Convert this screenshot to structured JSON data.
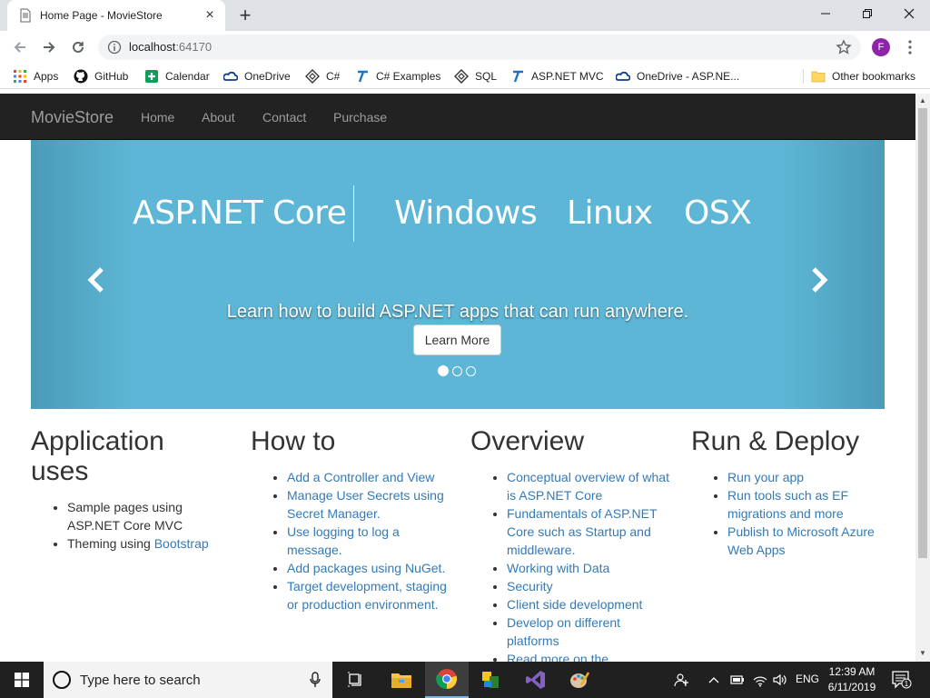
{
  "browser": {
    "tab_title": "Home Page - MovieStore",
    "url_host": "localhost",
    "url_port": ":64170",
    "profile_initial": "F",
    "bookmarks": [
      {
        "label": "Apps",
        "icon": "apps-grid-icon"
      },
      {
        "label": "GitHub",
        "icon": "github-icon"
      },
      {
        "label": "Calendar",
        "icon": "calendar-icon"
      },
      {
        "label": "OneDrive",
        "icon": "onedrive-icon"
      },
      {
        "label": "C#",
        "icon": "diamond-icon"
      },
      {
        "label": "C# Examples",
        "icon": "tutorial-t-icon"
      },
      {
        "label": "SQL",
        "icon": "diamond-icon"
      },
      {
        "label": "ASP.NET MVC",
        "icon": "tutorial-t-icon"
      },
      {
        "label": "OneDrive - ASP.NE...",
        "icon": "onedrive-icon"
      },
      {
        "label": "Other bookmarks",
        "icon": "folder-icon"
      }
    ]
  },
  "site": {
    "brand": "MovieStore",
    "nav": [
      "Home",
      "About",
      "Contact",
      "Purchase"
    ]
  },
  "carousel": {
    "hero_words": [
      "ASP.NET Core",
      "Windows",
      "Linux",
      "OSX"
    ],
    "caption": "Learn how to build ASP.NET apps that can run anywhere.",
    "button": "Learn More",
    "active_slide": 1,
    "slide_count": 3
  },
  "columns": [
    {
      "heading": "Application uses",
      "items": [
        {
          "text": "Sample pages using ASP.NET Core MVC",
          "link": ""
        },
        {
          "text": "Theming using ",
          "link": "Bootstrap"
        }
      ]
    },
    {
      "heading": "How to",
      "items": [
        {
          "text": "",
          "link": "Add a Controller and View"
        },
        {
          "text": "",
          "link": "Manage User Secrets using Secret Manager."
        },
        {
          "text": "",
          "link": "Use logging to log a message."
        },
        {
          "text": "",
          "link": "Add packages using NuGet."
        },
        {
          "text": "",
          "link": "Target development, staging or production environment."
        }
      ]
    },
    {
      "heading": "Overview",
      "items": [
        {
          "text": "",
          "link": "Conceptual overview of what is ASP.NET Core"
        },
        {
          "text": "",
          "link": "Fundamentals of ASP.NET Core such as Startup and middleware."
        },
        {
          "text": "",
          "link": "Working with Data"
        },
        {
          "text": "",
          "link": "Security"
        },
        {
          "text": "",
          "link": "Client side development"
        },
        {
          "text": "",
          "link": "Develop on different platforms"
        },
        {
          "text": "",
          "link": "Read more on the documentation site"
        }
      ]
    },
    {
      "heading": "Run & Deploy",
      "items": [
        {
          "text": "",
          "link": "Run your app"
        },
        {
          "text": "",
          "link": "Run tools such as EF migrations and more"
        },
        {
          "text": "",
          "link": "Publish to Microsoft Azure Web Apps"
        }
      ]
    }
  ],
  "taskbar": {
    "search_placeholder": "Type here to search",
    "language": "ENG",
    "time": "12:39 AM",
    "date": "6/11/2019",
    "notification_count": "1"
  },
  "colors": {
    "navbar_bg": "#222222",
    "carousel_bg": "#5db6d6",
    "link": "#337ab7",
    "taskbar_bg": "#202020"
  }
}
